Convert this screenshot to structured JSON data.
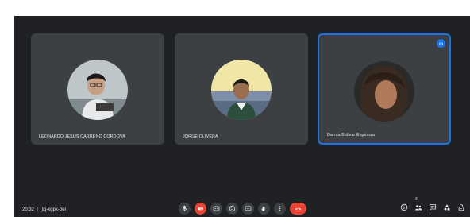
{
  "participants": [
    {
      "name": "LEONARDO JESUS CARREÑO CORDOVA"
    },
    {
      "name": "JORGE OLIVERA"
    },
    {
      "name": "Darma Bolivar Espinoza"
    }
  ],
  "meeting": {
    "time": "20:32",
    "separator": "|",
    "code": "jxj-kgpk-bei"
  },
  "people_count": "3",
  "colors": {
    "background": "#202124",
    "tile": "#3c4043",
    "accent": "#1a73e8",
    "danger": "#ea4335"
  },
  "icons": [
    "microphone-icon",
    "camera-off-icon",
    "captions-icon",
    "emoji-icon",
    "present-icon",
    "raise-hand-icon",
    "more-options-icon",
    "hang-up-icon",
    "info-icon",
    "people-icon",
    "chat-icon",
    "activities-icon",
    "host-controls-icon",
    "speaking-indicator-icon"
  ]
}
